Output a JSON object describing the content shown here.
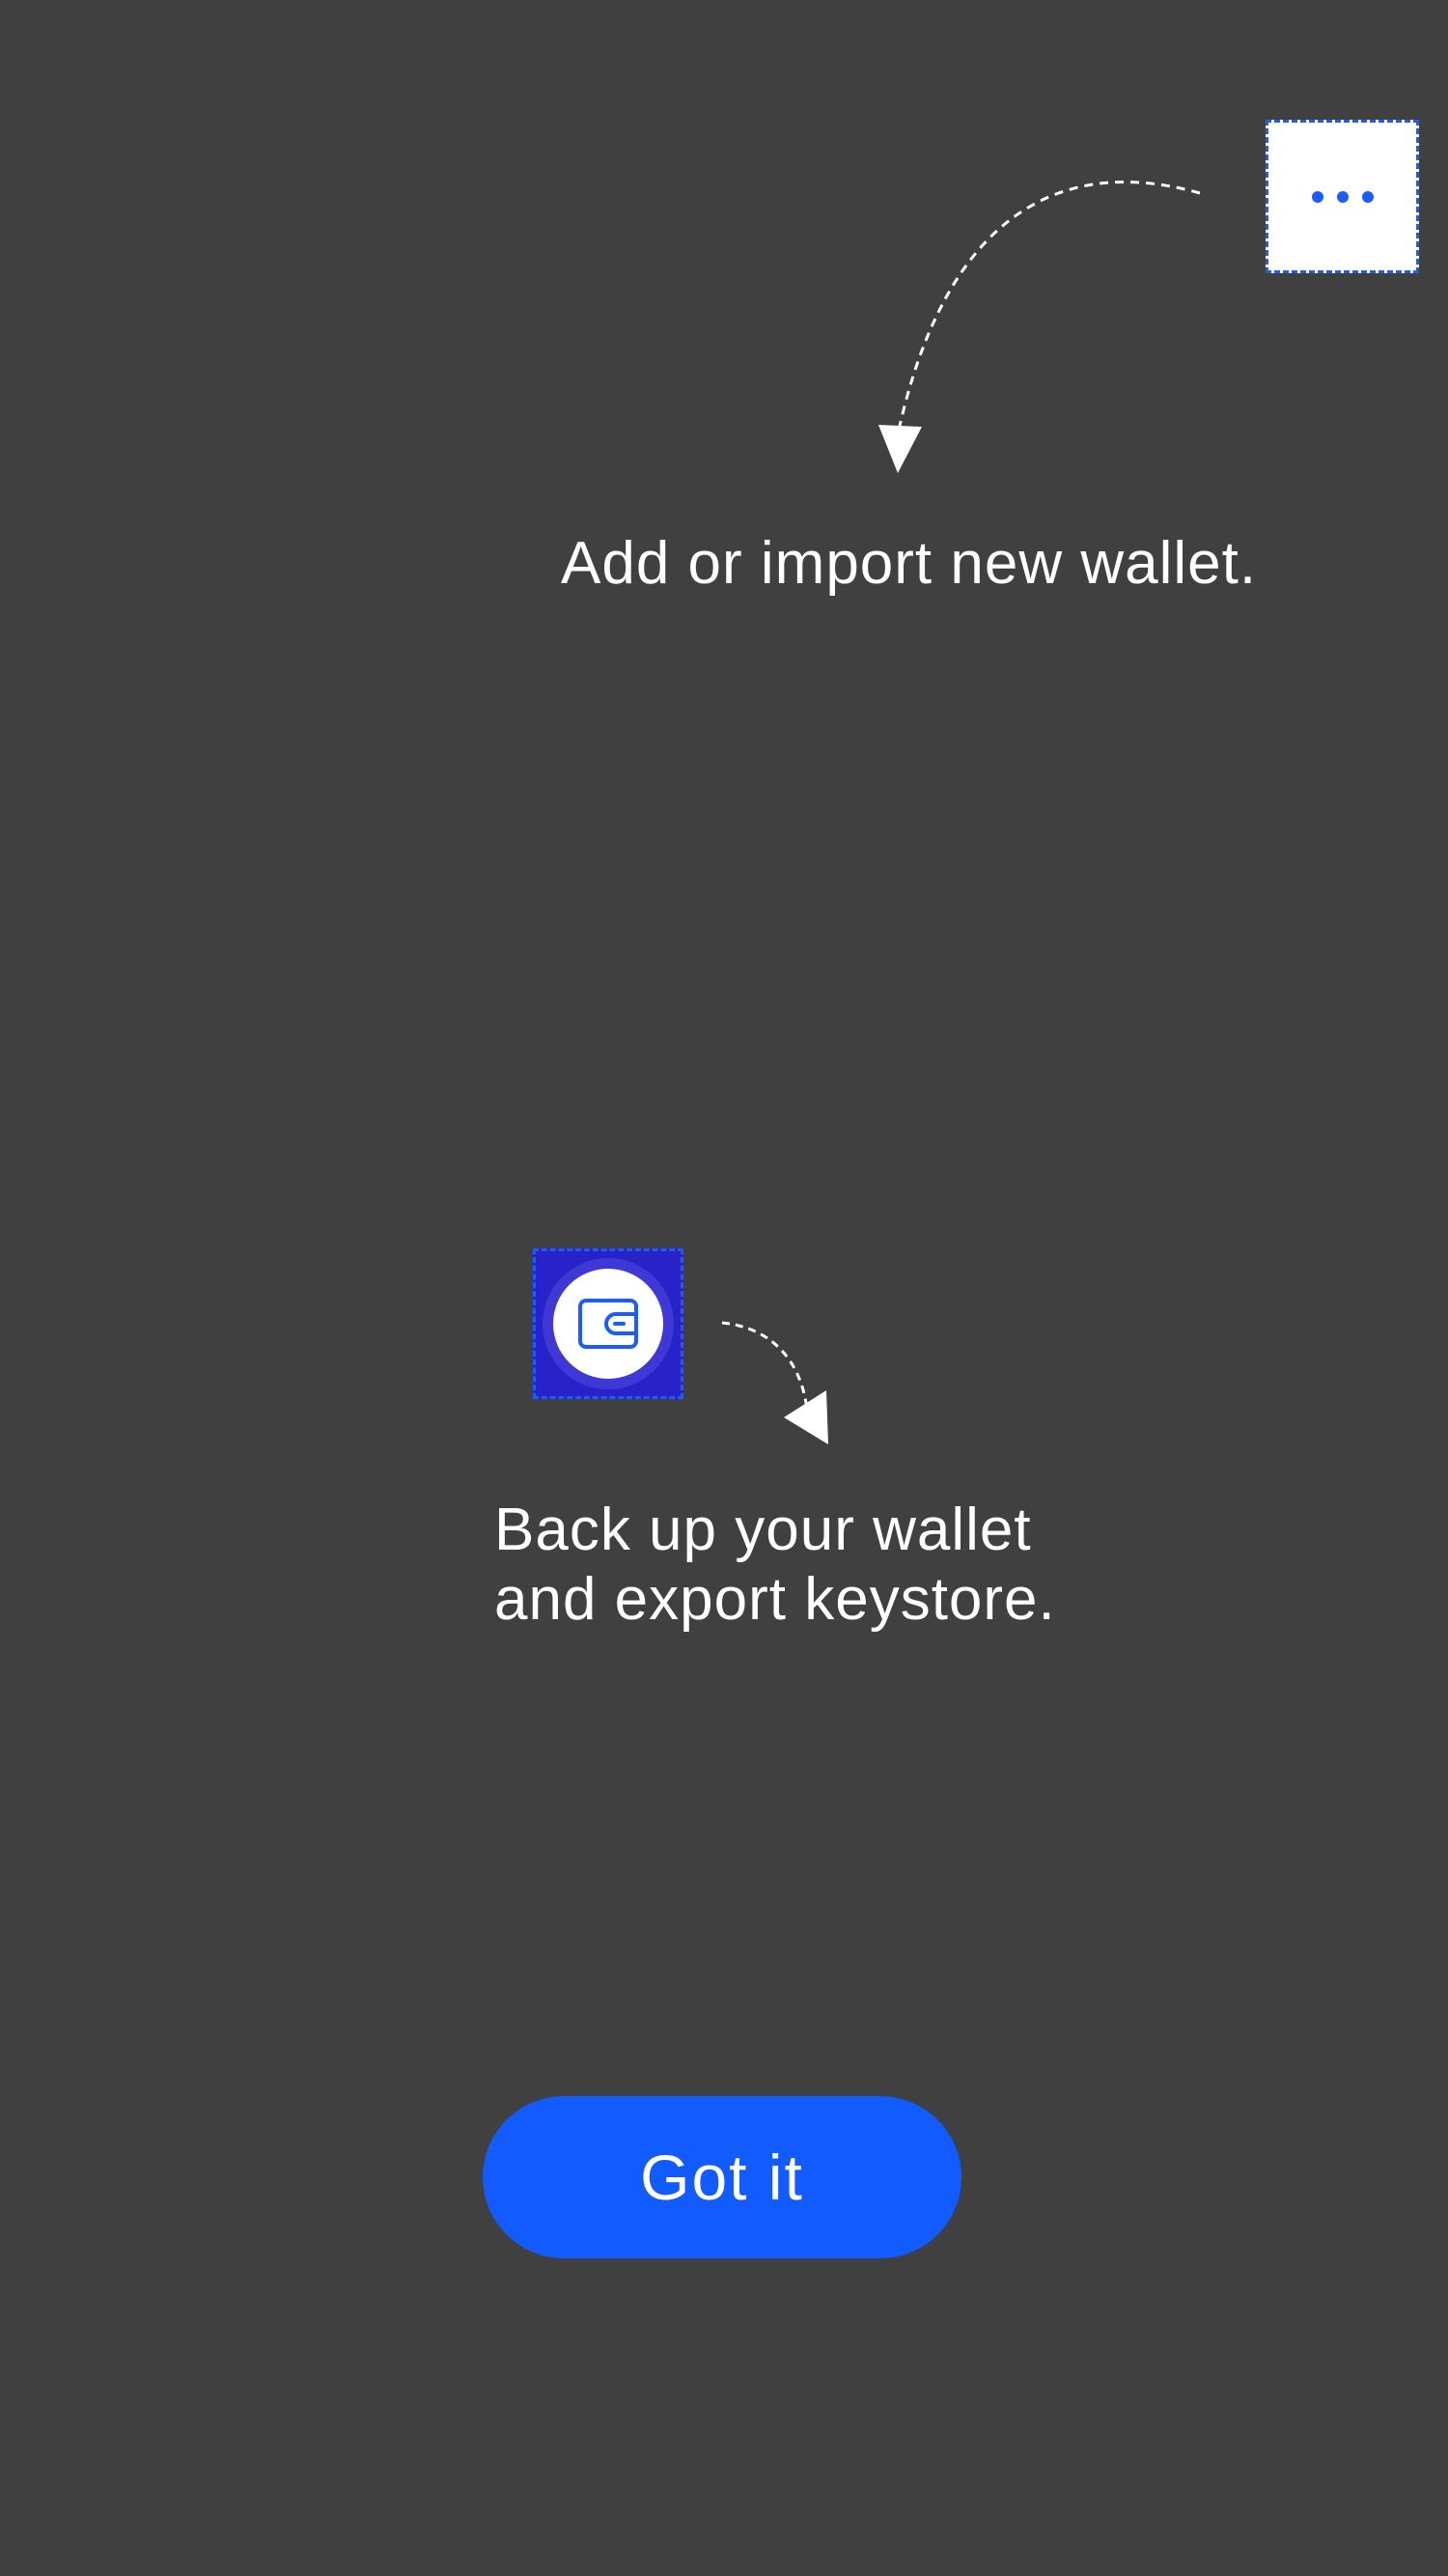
{
  "overlay": {
    "background_color": "#404040",
    "accent_color": "#115bff"
  },
  "more_button": {
    "icon": "more-horizontal-icon"
  },
  "tips": {
    "add_wallet": "Add or import new wallet.",
    "backup_wallet": "Back up your wallet\nand export keystore."
  },
  "wallet_button": {
    "icon": "wallet-icon"
  },
  "actions": {
    "got_it_label": "Got it"
  }
}
